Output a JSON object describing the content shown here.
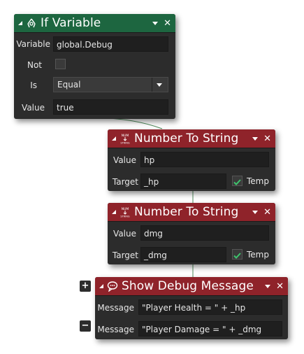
{
  "if_variable": {
    "title": "If Variable",
    "icon": "if-variable-icon",
    "variable_label": "Variable",
    "variable_value": "global.Debug",
    "not_label": "Not",
    "not_checked": false,
    "is_label": "Is",
    "is_value": "Equal",
    "value_label": "Value",
    "value_value": "true"
  },
  "number_to_string_1": {
    "title": "Number To String",
    "icon": "num-to-string-icon",
    "value_label": "Value",
    "value_value": "hp",
    "target_label": "Target",
    "target_value": "_hp",
    "temp_label": "Temp",
    "temp_checked": true
  },
  "number_to_string_2": {
    "title": "Number To String",
    "icon": "num-to-string-icon",
    "value_label": "Value",
    "value_value": "dmg",
    "target_label": "Target",
    "target_value": "_dmg",
    "temp_label": "Temp",
    "temp_checked": true
  },
  "show_debug_message": {
    "title": "Show Debug Message",
    "icon": "speech-bubble-icon",
    "message_label_1": "Message",
    "message_value_1": "\"Player Health = \" + _hp",
    "message_label_2": "Message",
    "message_value_2": "\"Player Damage = \" + _dmg",
    "add_button": "+",
    "remove_button": "−"
  },
  "colors": {
    "if_header": "#1d6640",
    "action_header": "#8f232a",
    "panel": "#2c2c2c",
    "checkmark": "#3ec46d"
  }
}
